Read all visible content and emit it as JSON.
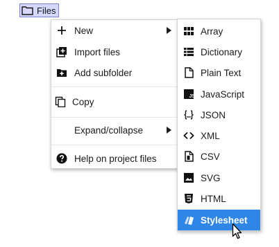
{
  "files_chip": {
    "label": "Files",
    "icon": "folder-outline-icon"
  },
  "main_menu": {
    "items": [
      {
        "label": "New",
        "icon": "plus-icon",
        "has_submenu": true
      },
      {
        "label": "Import files",
        "icon": "import-files-icon",
        "has_submenu": false
      },
      {
        "label": "Add subfolder",
        "icon": "add-folder-icon",
        "has_submenu": false
      },
      {
        "label": "Copy",
        "icon": "copy-icon",
        "has_submenu": false
      },
      {
        "label": "Expand/collapse",
        "icon": "",
        "has_submenu": true
      },
      {
        "label": "Help on project files",
        "icon": "help-circle-icon",
        "has_submenu": false
      }
    ]
  },
  "sub_menu": {
    "items": [
      {
        "label": "Array",
        "icon": "grid-icon"
      },
      {
        "label": "Dictionary",
        "icon": "list-icon"
      },
      {
        "label": "Plain Text",
        "icon": "file-outline-icon"
      },
      {
        "label": "JavaScript",
        "icon": "js-icon"
      },
      {
        "label": "JSON",
        "icon": "json-braces-icon"
      },
      {
        "label": "XML",
        "icon": "code-brackets-icon"
      },
      {
        "label": "CSV",
        "icon": "csv-file-icon"
      },
      {
        "label": "SVG",
        "icon": "image-icon"
      },
      {
        "label": "HTML",
        "icon": "html5-icon"
      },
      {
        "label": "Stylesheet",
        "icon": "css-stylesheet-icon",
        "active": true
      }
    ]
  },
  "colors": {
    "active_bg": "#2f86e6",
    "chip_bg": "#d6d8ff",
    "chip_border": "#7b7fd8"
  }
}
